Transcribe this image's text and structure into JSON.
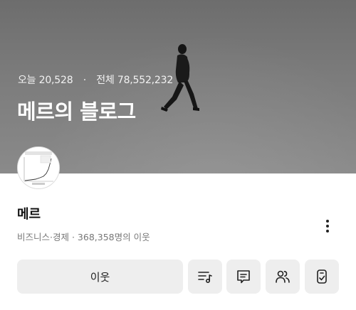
{
  "header": {
    "today_label": "오늘",
    "today_count": "20,528",
    "separator": "·",
    "total_label": "전체",
    "total_count": "78,552,232",
    "blog_title": "메르의 블로그"
  },
  "profile": {
    "nickname": "메르",
    "category": "비즈니스·경제",
    "neighbors_text": "· 368,358명의 이웃",
    "more_icon": "more-vertical-icon"
  },
  "actions": {
    "neighbor_label": "이웃",
    "icons": [
      "playlist-music-icon",
      "comment-icon",
      "users-icon",
      "mobile-link-icon"
    ]
  },
  "colors": {
    "button_bg": "#eeeeee",
    "text_primary": "#111111",
    "text_secondary": "#777777"
  }
}
